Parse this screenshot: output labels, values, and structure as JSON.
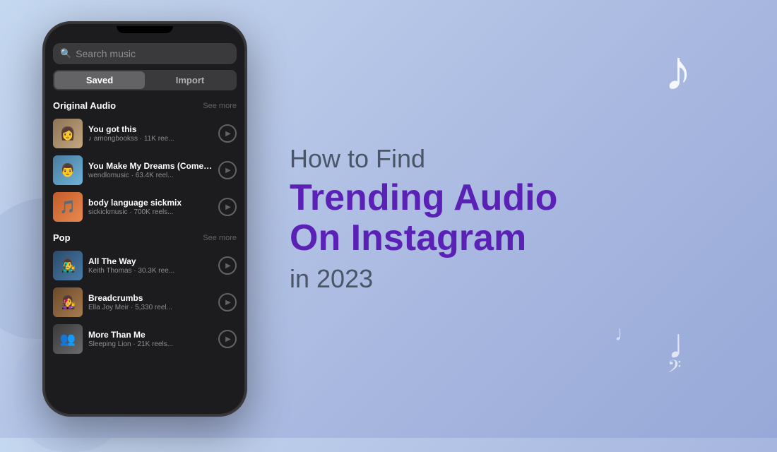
{
  "background": {
    "color_start": "#c5d8f0",
    "color_end": "#98a8d8"
  },
  "phone": {
    "search_placeholder": "Search music",
    "tabs": [
      {
        "label": "Saved",
        "active": true
      },
      {
        "label": "Import",
        "active": false
      }
    ],
    "sections": [
      {
        "title": "Original Audio",
        "see_more": "See more",
        "songs": [
          {
            "title": "You got this",
            "meta": "♪ amongbookss · 11K ree...",
            "thumb_class": "thumb-1",
            "emoji": "👩"
          },
          {
            "title": "You Make My Dreams (Come Tru...",
            "meta": "wendlomusic · 63.4K reel...",
            "thumb_class": "thumb-2",
            "emoji": "👨"
          },
          {
            "title": "body language sickmix",
            "meta": "sickickmusic · 700K reels...",
            "thumb_class": "thumb-3",
            "emoji": "🎵"
          }
        ]
      },
      {
        "title": "Pop",
        "see_more": "See more",
        "songs": [
          {
            "title": "All The Way",
            "meta": "Keith Thomas · 30.3K ree...",
            "thumb_class": "thumb-4",
            "emoji": "👨‍🎤"
          },
          {
            "title": "Breadcrumbs",
            "meta": "Ella Joy Meir · 5,330 reel...",
            "thumb_class": "thumb-5",
            "emoji": "👩‍🎤"
          },
          {
            "title": "More Than Me",
            "meta": "Sleeping Lion · 21K reels...",
            "thumb_class": "thumb-6",
            "emoji": "👥"
          }
        ]
      }
    ]
  },
  "right_content": {
    "how_to": "How to Find",
    "trending_line1": "Trending Audio",
    "trending_line2": "On Instagram",
    "year": "in 2023"
  },
  "icons": {
    "music_note": "♪",
    "bass_clef": "𝄢",
    "small_note": "♩",
    "search": "🔍",
    "play": "▶"
  }
}
